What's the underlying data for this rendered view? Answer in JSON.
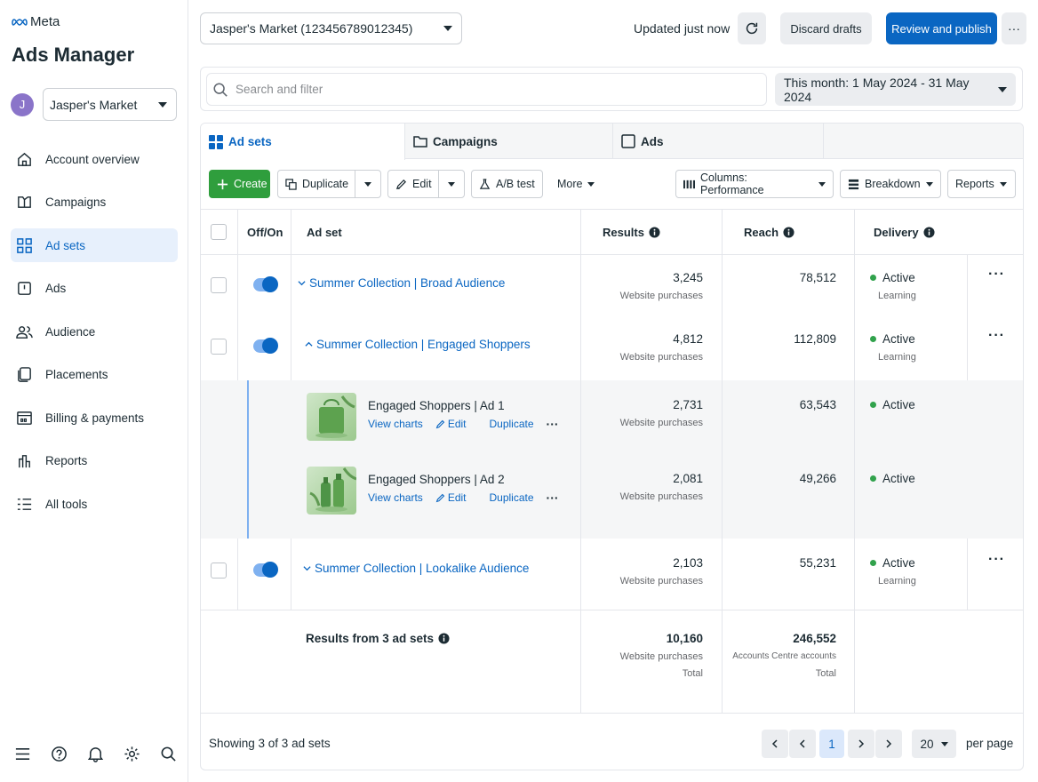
{
  "sidebar": {
    "logo": "Meta",
    "title": "Ads Manager",
    "account": {
      "initial": "J",
      "name": "Jasper's Market"
    },
    "items": [
      {
        "label": "Account overview",
        "icon": "home-icon"
      },
      {
        "label": "Campaigns",
        "icon": "campaigns-icon"
      },
      {
        "label": "Ad sets",
        "icon": "grid-icon"
      },
      {
        "label": "Ads",
        "icon": "ad-icon"
      },
      {
        "label": "Audience",
        "icon": "audience-icon"
      },
      {
        "label": "Placements",
        "icon": "placements-icon"
      },
      {
        "label": "Billing & payments",
        "icon": "billing-icon"
      },
      {
        "label": "Reports",
        "icon": "reports-icon"
      },
      {
        "label": "All tools",
        "icon": "all-tools-icon"
      }
    ],
    "active_item": "Ad sets",
    "bottom_icons": [
      "menu-icon",
      "help-icon",
      "bell-icon",
      "settings-icon",
      "search-icon"
    ]
  },
  "topbar": {
    "account_select": "Jasper's Market (123456789012345)",
    "updated": "Updated just now",
    "discard": "Discard drafts",
    "publish": "Review and publish",
    "more": "···"
  },
  "filter": {
    "search_placeholder": "Search and filter",
    "date_range": "This month: 1 May 2024 - 31 May 2024"
  },
  "tabs": [
    {
      "label": "Ad sets",
      "active": true
    },
    {
      "label": "Campaigns",
      "active": false
    },
    {
      "label": "Ads",
      "active": false
    }
  ],
  "toolbar": {
    "create": "Create",
    "duplicate": "Duplicate",
    "edit": "Edit",
    "ab_test": "A/B test",
    "more": "More",
    "columns": "Columns: Performance",
    "breakdown": "Breakdown",
    "reports": "Reports"
  },
  "table": {
    "headers": {
      "onoff": "Off/On",
      "adset": "Ad set",
      "results": "Results",
      "reach": "Reach",
      "delivery": "Delivery"
    },
    "rows": [
      {
        "name": "Summer Collection | Broad Audience",
        "expanded": false,
        "results": "3,245",
        "results_label": "Website purchases",
        "reach": "78,512",
        "status": "Active",
        "substatus": "Learning"
      },
      {
        "name": "Summer Collection | Engaged Shoppers",
        "expanded": true,
        "results": "4,812",
        "results_label": "Website purchases",
        "reach": "112,809",
        "status": "Active",
        "substatus": "Learning"
      },
      {
        "name": "Summer Collection | Lookalike Audience",
        "expanded": false,
        "results": "2,103",
        "results_label": "Website purchases",
        "reach": "55,231",
        "status": "Active",
        "substatus": "Learning"
      }
    ],
    "ads": [
      {
        "name": "Engaged Shoppers | Ad 1",
        "results": "2,731",
        "results_label": "Website purchases",
        "reach": "63,543",
        "status": "Active"
      },
      {
        "name": "Engaged Shoppers | Ad 2",
        "results": "2,081",
        "results_label": "Website purchases",
        "reach": "49,266",
        "status": "Active"
      }
    ],
    "ad_actions": {
      "view_charts": "View charts",
      "edit": "Edit",
      "duplicate": "Duplicate"
    },
    "summary": {
      "label": "Results from 3 ad sets",
      "results": "10,160",
      "results_label": "Website purchases",
      "results_total": "Total",
      "reach": "246,552",
      "reach_label": "Accounts Centre accounts",
      "reach_total": "Total"
    }
  },
  "footer": {
    "showing": "Showing 3 of 3 ad sets",
    "page": "1",
    "per_page_value": "20",
    "per_page_label": "per page"
  },
  "colors": {
    "accent": "#0a66c2",
    "create": "#2f9e3d",
    "active_dot": "#31a24c"
  }
}
